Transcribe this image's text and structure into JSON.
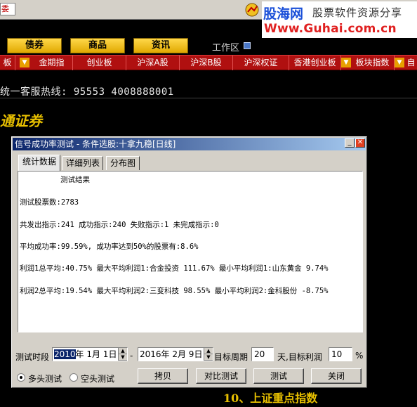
{
  "topbar": {
    "entrust_label": "委托"
  },
  "banner": {
    "site": "股海网",
    "slogan": "股票软件资源分享",
    "url": "Www.Guhai.com.cn"
  },
  "categories": [
    "债券",
    "商品",
    "资讯"
  ],
  "workarea": "工作区",
  "tabs": [
    "板",
    "金期指",
    "创业板",
    "沪深A股",
    "沪深B股",
    "沪深权证",
    "香港创业板",
    "板块指数",
    "自"
  ],
  "hotline": "统一客服热线: 95553 4008888001",
  "brand": "通证券",
  "bottom_text": "10、上证重点指数",
  "dialog": {
    "title": "信号成功率测试 - 条件选股:十拿九稳[日线]",
    "tabs": [
      "统计数据",
      "详细列表",
      "分布图"
    ],
    "results": {
      "heading": "测试结果",
      "line1": "测试股票数:2783",
      "line2": "共发出指示:241 成功指示:240 失败指示:1 未完成指示:0",
      "line3": "平均成功率:99.59%, 成功率达到50%的股票有:8.6%",
      "line4": "利润1总平均:40.75% 最大平均利润1:合金投资 111.67% 最小平均利润1:山东黄金 9.74%",
      "line5": "利润2总平均:19.54% 最大平均利润2:三变科技 98.55% 最小平均利润2:金科股份 -8.75%"
    },
    "period_label": "测试时段",
    "start_year": "2010",
    "start_rest": "年 1月 1日",
    "dash": "-",
    "end_date": "2016年 2月 9日",
    "target_period_label": "目标周期",
    "target_period": "20",
    "target_profit_label": "天,目标利润",
    "target_profit": "10",
    "percent": "%",
    "radio_long": "多头测试",
    "radio_short": "空头测试",
    "buttons": {
      "copy": "拷贝",
      "compare": "对比测试",
      "test": "测试",
      "close": "关闭"
    }
  },
  "colors": {
    "tab_bar": "#b01010",
    "title_bar": "#0a246a",
    "accent_yellow": "#e8c000"
  }
}
